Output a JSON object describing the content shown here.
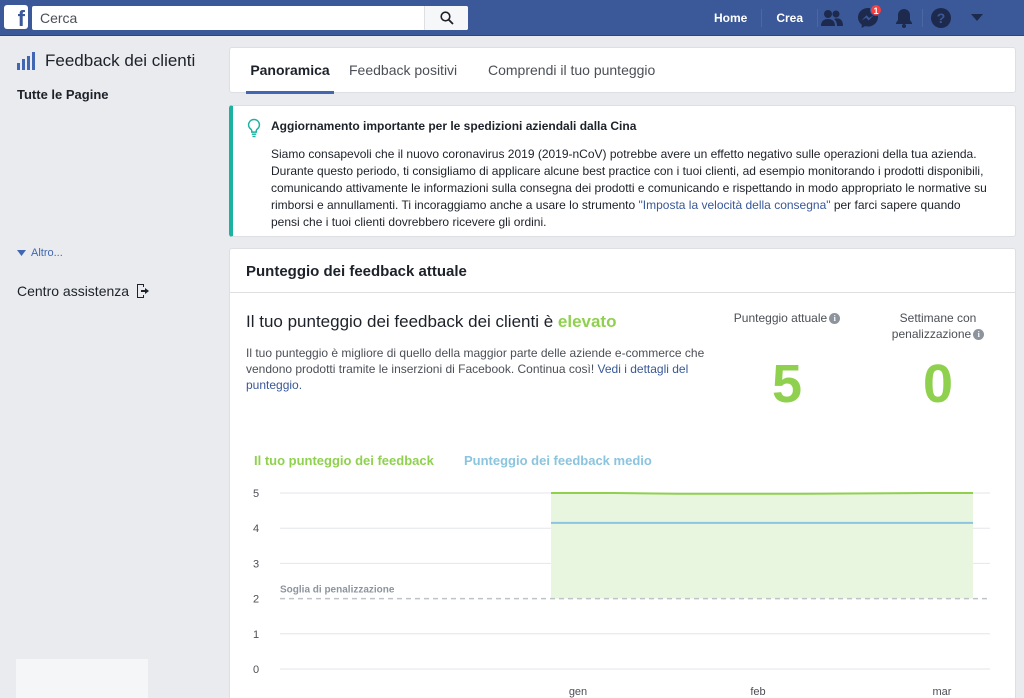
{
  "topbar": {
    "logo": "f",
    "search_placeholder": "Cerca",
    "nav": [
      "Home",
      "Crea"
    ],
    "icons": [
      "friends-icon",
      "messenger-icon",
      "notifications-icon",
      "help-icon",
      "dropdown-caret-icon"
    ],
    "messenger_badge": "1"
  },
  "sidebar": {
    "title": "Feedback dei clienti",
    "subtitle": "Tutte le Pagine",
    "more": "Altro...",
    "help": "Centro assistenza"
  },
  "tabs": [
    "Panoramica",
    "Feedback positivi",
    "Comprendi il tuo punteggio"
  ],
  "notice": {
    "title": "Aggiornamento importante per le spedizioni aziendali dalla Cina",
    "body_before": "Siamo consapevoli che il nuovo coronavirus 2019 (2019-nCoV) potrebbe avere un effetto negativo sulle operazioni della tua azienda. Durante questo periodo, ti consigliamo di applicare alcune best practice con i tuoi clienti, ad esempio monitorando i prodotti disponibili, comunicando attivamente le informazioni sulla consegna dei prodotti e comunicando e rispettando in modo appropriato le normative su rimborsi e annullamenti. Ti incoraggiamo anche a usare lo strumento ",
    "link": "\"Imposta la velocità della consegna\"",
    "body_after": " per farci sapere quando pensi che i tuoi clienti dovrebbero ricevere gli ordini."
  },
  "score": {
    "header": "Punteggio dei feedback attuale",
    "title_prefix": "Il tuo punteggio dei feedback dei clienti è ",
    "title_highlight": "elevato",
    "desc": "Il tuo punteggio è migliore di quello della maggior parte delle aziende e-commerce che vendono prodotti tramite le inserzioni di Facebook. Continua così! ",
    "desc_link": "Vedi i dettagli del punteggio.",
    "current_label": "Punteggio attuale",
    "current_value": "5",
    "weeks_label": "Settimane con penalizzazione",
    "weeks_value": "0",
    "info_glyph": "i"
  },
  "chart_data": {
    "type": "area",
    "series": [
      {
        "name": "Il tuo punteggio dei feedback",
        "color": "#8fd14f",
        "x": [
          0,
          0.15,
          0.3,
          0.45,
          0.6,
          0.75,
          0.9,
          1.0
        ],
        "values": [
          5,
          5,
          4.98,
          4.98,
          4.98,
          4.99,
          5,
          5
        ]
      },
      {
        "name": "Punteggio dei feedback medio",
        "color": "#8ac4de",
        "x": [
          0,
          1.0
        ],
        "values": [
          4.15,
          4.15
        ]
      }
    ],
    "y_ticks": [
      "5",
      "4",
      "3",
      "2",
      "1",
      "0"
    ],
    "ylim": [
      0,
      5
    ],
    "x_tick_labels": [
      "gen",
      "feb",
      "mar"
    ],
    "threshold": {
      "label": "Soglia di penalizzazione",
      "value": 2
    }
  }
}
